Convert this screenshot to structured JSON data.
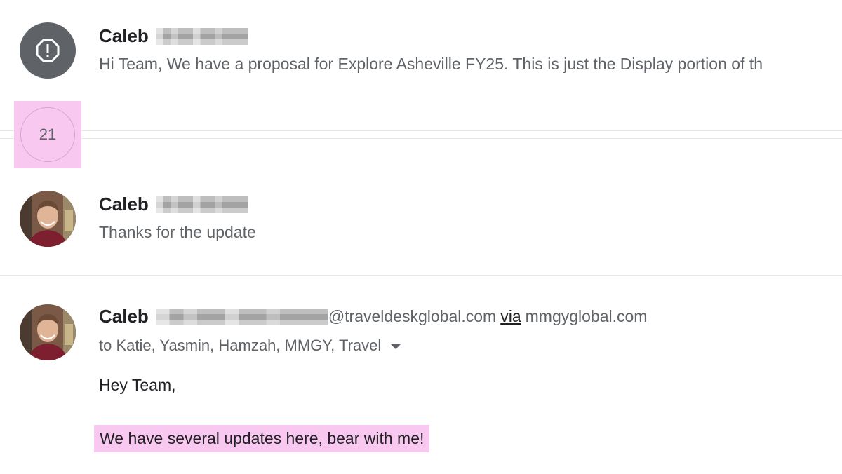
{
  "thread": {
    "collapsed_count": "21",
    "messages": [
      {
        "sender_first": "Caleb",
        "snippet": "Hi Team, We have a proposal for Explore Asheville FY25. This is just the Display portion of th"
      },
      {
        "sender_first": "Caleb",
        "snippet": "Thanks for the update"
      }
    ],
    "open_message": {
      "sender_first": "Caleb",
      "email_domain": "@traveldeskglobal.com",
      "via_label": "via",
      "via_domain": "mmgyglobal.com",
      "recipients": "to Katie, Yasmin, Hamzah, MMGY, Travel",
      "greeting": "Hey Team,",
      "highlighted_line": "We have several updates here, bear with me!"
    }
  },
  "icons": {
    "alert": "alert-octagon-icon",
    "recipients_dropdown": "caret-down-icon"
  },
  "colors": {
    "highlight": "#f9c8f0",
    "alert_avatar_bg": "#5f6368",
    "muted_text": "#5f6368"
  }
}
